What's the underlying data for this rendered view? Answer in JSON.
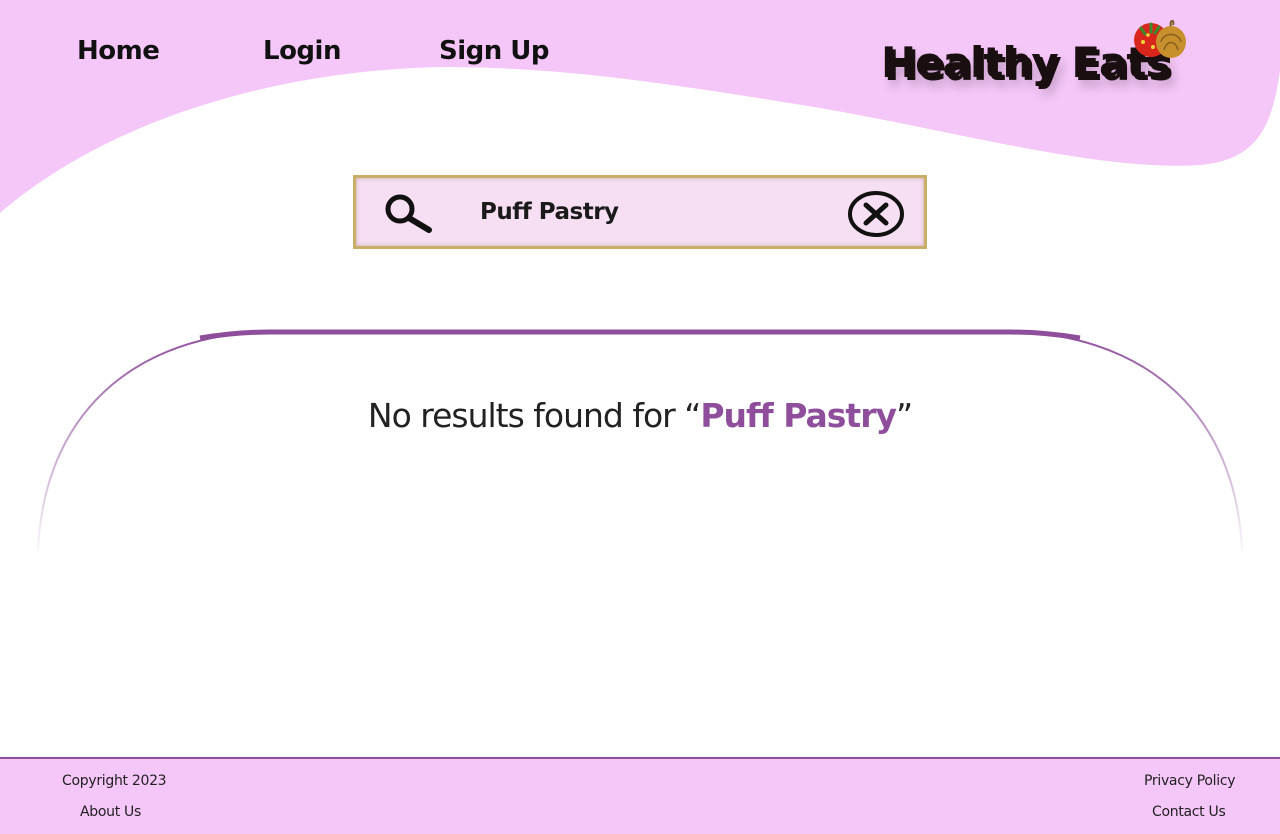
{
  "header": {
    "nav": {
      "home": "Home",
      "login": "Login",
      "signup": "Sign Up"
    },
    "logo_text": "Healthy Eats"
  },
  "search": {
    "value": "Puff Pastry",
    "icon": "search-icon",
    "clear_icon": "close-circle-icon"
  },
  "results": {
    "prefix": "No results found for “",
    "query": "Puff Pastry",
    "suffix": "”"
  },
  "footer": {
    "copyright": "Copyright 2023",
    "about": "About Us",
    "privacy": "Privacy Policy",
    "contact": "Contact Us"
  },
  "colors": {
    "header_pink": "#f5c6f8",
    "accent_purple": "#8e4e9b",
    "search_bg": "#f6def3",
    "search_border": "#c8b066"
  }
}
